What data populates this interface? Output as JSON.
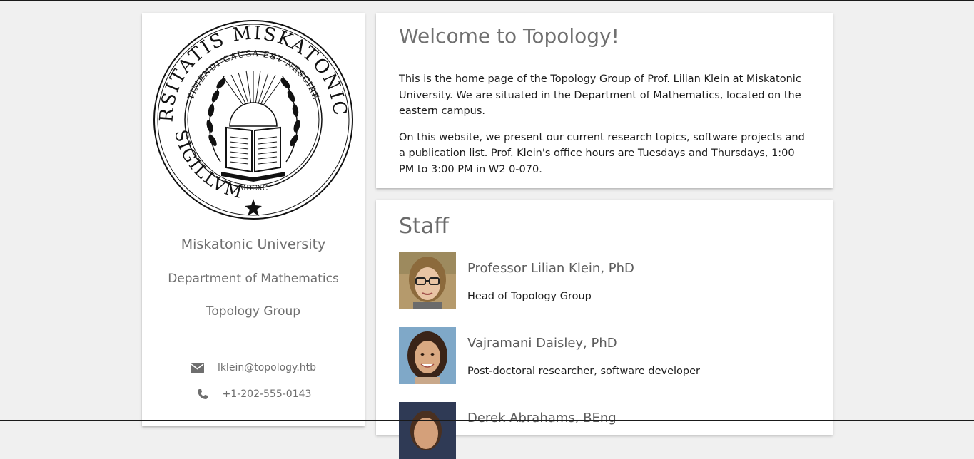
{
  "sidebar": {
    "seal": {
      "outer_text": "UNIVERSITATIS MISKATONICIENSIS",
      "outer_text_bottom": "SIGILLVM",
      "inner_text": "TIMENDI CAUSA EST NESCIRE",
      "year": "MDCXC"
    },
    "university": "Miskatonic University",
    "department": "Department of Mathematics",
    "group": "Topology Group",
    "email": "lklein@topology.htb",
    "email_icon": "envelope-icon",
    "phone": "+1-202-555-0143",
    "phone_icon": "phone-icon"
  },
  "welcome": {
    "title": "Welcome to Topology!",
    "paragraph1": "This is the home page of the Topology Group of Prof. Lilian Klein at Miskatonic University. We are situated in the Department of Mathematics, located on the eastern campus.",
    "paragraph2": "On this website, we present our current research topics, software projects and a publication list. Prof. Klein's office hours are Tuesdays and Thursdays, 1:00 PM to 3:00 PM in W2 0-070."
  },
  "staff": {
    "title": "Staff",
    "members": [
      {
        "name": "Professor Lilian Klein, PhD",
        "role": "Head of Topology Group"
      },
      {
        "name": "Vajramani Daisley, PhD",
        "role": "Post-doctoral researcher, software developer"
      },
      {
        "name": "Derek Abrahams, BEng",
        "role": ""
      }
    ]
  },
  "colors": {
    "background": "#f0f0f0",
    "card": "#ffffff",
    "heading_gray": "#707070",
    "body_text": "#1c1c1c"
  }
}
